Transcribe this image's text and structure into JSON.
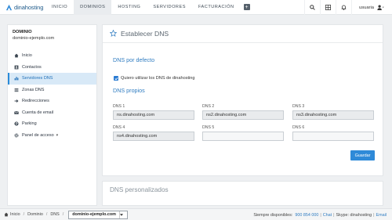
{
  "brand": {
    "name": "dinahosting"
  },
  "nav": {
    "items": [
      "INICIO",
      "DOMINIOS",
      "HOSTING",
      "SERVIDORES",
      "FACTURACIÓN"
    ],
    "active_index": 1,
    "plus": "+",
    "user": "usuaria"
  },
  "sidebar": {
    "title": "DOMINIO",
    "domain": "dominio-ejemplo.com",
    "items": [
      {
        "label": "Inicio",
        "icon": "home-icon"
      },
      {
        "label": "Contactos",
        "icon": "contacts-icon"
      },
      {
        "label": "Servidores DNS",
        "icon": "bars-icon",
        "active": true
      },
      {
        "label": "Zonas DNS",
        "icon": "list-icon"
      },
      {
        "label": "Redirecciones",
        "icon": "redirect-icon"
      },
      {
        "label": "Cuenta de email",
        "icon": "email-icon"
      },
      {
        "label": "Parking",
        "icon": "parking-icon"
      },
      {
        "label": "Panel de acceso",
        "icon": "gear-icon",
        "caret": "▾"
      }
    ]
  },
  "main": {
    "title": "Establecer DNS",
    "default_section": "DNS por defecto",
    "checkbox_label": "Quiero utilizar los DNS de dinahosting",
    "checkbox_checked": true,
    "own_section": "DNS propios",
    "fields": [
      {
        "label": "DNS 1",
        "value": "ns.dinahosting.com"
      },
      {
        "label": "DNS 2",
        "value": "ns2.dinahosting.com"
      },
      {
        "label": "DNS 3",
        "value": "ns3.dinahosting.com"
      },
      {
        "label": "DNS 4",
        "value": "ns4.dinahosting.com"
      },
      {
        "label": "DNS 5",
        "value": ""
      },
      {
        "label": "DNS 6",
        "value": ""
      }
    ],
    "save_label": "Guardar"
  },
  "custom_panel": {
    "title": "DNS personalizados"
  },
  "footer": {
    "breadcrumb": [
      "Inicio",
      "Dominio",
      "DNS"
    ],
    "separator": "/",
    "selected_domain": "dominio-ejemplo.com",
    "support_label": "Siempre disponibles:",
    "phone": "900 854 000",
    "chat": "Chat",
    "skype": "Skype: dinahosting",
    "email": "Email"
  },
  "colors": {
    "accent": "#2f8ad8",
    "active_bg": "#d8e9f7"
  }
}
